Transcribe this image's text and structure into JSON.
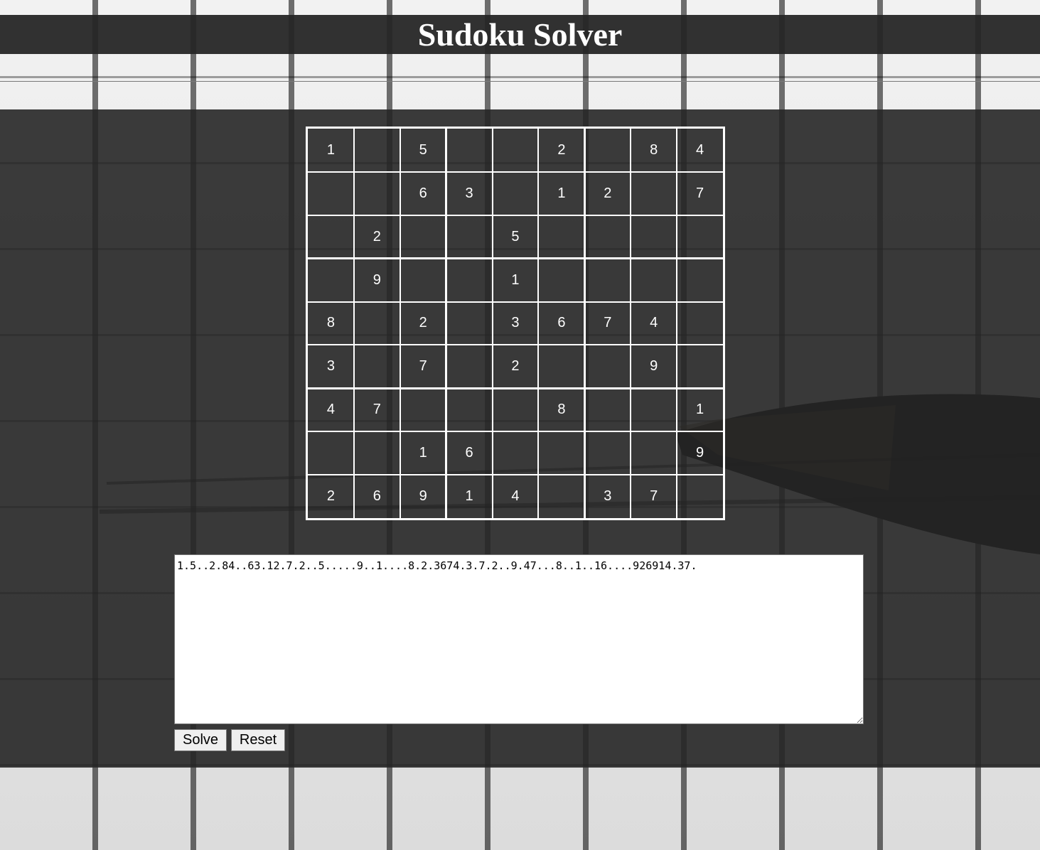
{
  "page": {
    "title": "Sudoku Solver"
  },
  "board": {
    "rows": [
      [
        "1",
        "",
        "5",
        "",
        "",
        "2",
        "",
        "8",
        "4"
      ],
      [
        "",
        "",
        "6",
        "3",
        "",
        "1",
        "2",
        "",
        "7"
      ],
      [
        "",
        "2",
        "",
        "",
        "5",
        "",
        "",
        "",
        ""
      ],
      [
        "",
        "9",
        "",
        "",
        "1",
        "",
        "",
        "",
        ""
      ],
      [
        "8",
        "",
        "2",
        "",
        "3",
        "6",
        "7",
        "4",
        ""
      ],
      [
        "3",
        "",
        "7",
        "",
        "2",
        "",
        "",
        "9",
        ""
      ],
      [
        "4",
        "7",
        "",
        "",
        "",
        "8",
        "",
        "",
        "1"
      ],
      [
        "",
        "",
        "1",
        "6",
        "",
        "",
        "",
        "",
        "9"
      ],
      [
        "2",
        "6",
        "9",
        "1",
        "4",
        "",
        "3",
        "7",
        ""
      ]
    ]
  },
  "puzzle_input": {
    "value": "1.5..2.84..63.12.7.2..5.....9..1....8.2.3674.3.7.2..9.47...8..1..16....926914.37."
  },
  "buttons": {
    "solve_label": "Solve",
    "reset_label": "Reset"
  },
  "colors": {
    "panel": "#262626",
    "board_lines": "#ffffff",
    "digit": "#ffffff"
  }
}
